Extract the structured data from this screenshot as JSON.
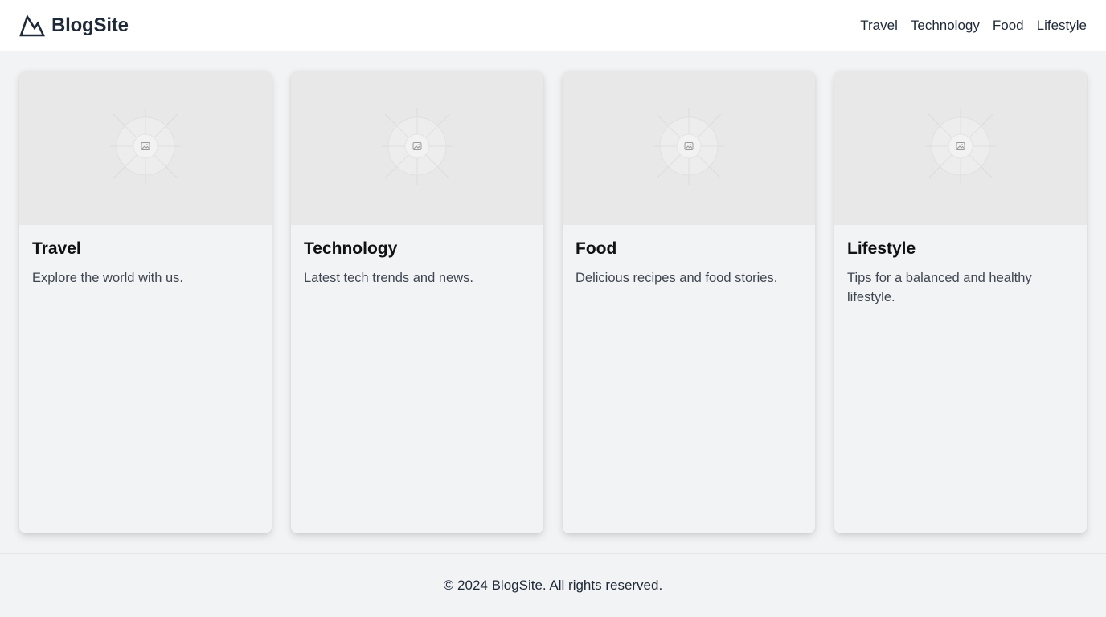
{
  "brand": {
    "name": "BlogSite",
    "logo_icon": "mountain-icon"
  },
  "nav": {
    "items": [
      "Travel",
      "Technology",
      "Food",
      "Lifestyle"
    ]
  },
  "cards": [
    {
      "title": "Travel",
      "description": "Explore the world with us.",
      "image_icon": "image-placeholder-icon"
    },
    {
      "title": "Technology",
      "description": "Latest tech trends and news.",
      "image_icon": "image-placeholder-icon"
    },
    {
      "title": "Food",
      "description": "Delicious recipes and food stories.",
      "image_icon": "image-placeholder-icon"
    },
    {
      "title": "Lifestyle",
      "description": "Tips for a balanced and healthy lifestyle.",
      "image_icon": "image-placeholder-icon"
    }
  ],
  "footer": {
    "text": "© 2024 BlogSite. All rights reserved."
  },
  "colors": {
    "page_bg": "#f2f3f5",
    "header_bg": "#ffffff",
    "image_bg": "#e8e8e8",
    "text": "#1f2937"
  }
}
